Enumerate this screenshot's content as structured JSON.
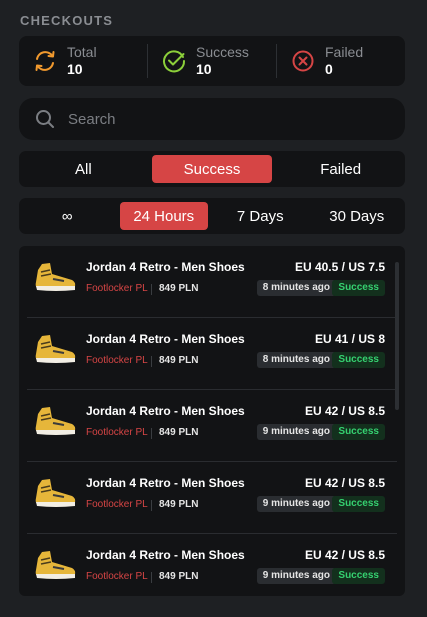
{
  "heading": "CHECKOUTS",
  "stats": [
    {
      "label": "Total",
      "value": "10",
      "icon": "sync-icon",
      "color": "#f29a2e"
    },
    {
      "label": "Success",
      "value": "10",
      "icon": "check-circle-icon",
      "color": "#8ccf3a"
    },
    {
      "label": "Failed",
      "value": "0",
      "icon": "x-circle-icon",
      "color": "#d64545"
    }
  ],
  "search": {
    "placeholder": "Search"
  },
  "status_filter": {
    "options": [
      "All",
      "Success",
      "Failed"
    ],
    "selected": "Success"
  },
  "time_filter": {
    "options": [
      "∞",
      "24 Hours",
      "7 Days",
      "30 Days"
    ],
    "selected": "24 Hours"
  },
  "accent_color": "#d64545",
  "checkouts": [
    {
      "product": "Jordan 4 Retro - Men Shoes",
      "store": "Footlocker PL",
      "price": "849 PLN",
      "size": "EU 40.5 / US 7.5",
      "time": "8 minutes ago",
      "status": "Success"
    },
    {
      "product": "Jordan 4 Retro - Men Shoes",
      "store": "Footlocker PL",
      "price": "849 PLN",
      "size": "EU 41 / US 8",
      "time": "8 minutes ago",
      "status": "Success"
    },
    {
      "product": "Jordan 4 Retro - Men Shoes",
      "store": "Footlocker PL",
      "price": "849 PLN",
      "size": "EU 42 / US 8.5",
      "time": "9 minutes ago",
      "status": "Success"
    },
    {
      "product": "Jordan 4 Retro - Men Shoes",
      "store": "Footlocker PL",
      "price": "849 PLN",
      "size": "EU 42 / US 8.5",
      "time": "9 minutes ago",
      "status": "Success"
    },
    {
      "product": "Jordan 4 Retro - Men Shoes",
      "store": "Footlocker PL",
      "price": "849 PLN",
      "size": "EU 42 / US 8.5",
      "time": "9 minutes ago",
      "status": "Success"
    }
  ]
}
